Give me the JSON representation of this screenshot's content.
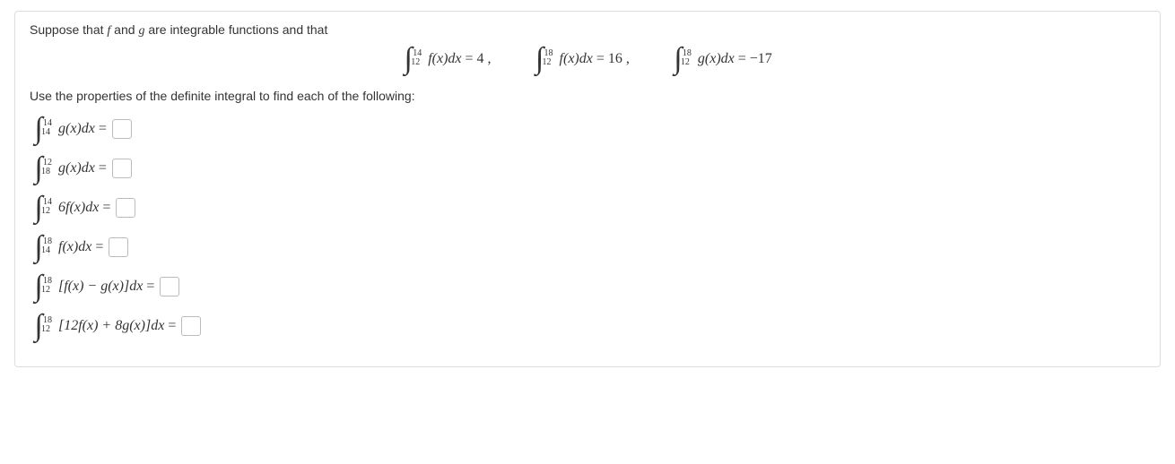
{
  "intro": {
    "pre": "Suppose that ",
    "f": "f",
    "mid": " and ",
    "g": "g",
    "post": " are integrable functions and that"
  },
  "given": {
    "int1": {
      "lower": "12",
      "upper": "14",
      "body": "f(x)dx",
      "eq": "= 4 ,",
      "result": ""
    },
    "int2": {
      "lower": "12",
      "upper": "18",
      "body": "f(x)dx",
      "eq": "= 16 ,",
      "result": ""
    },
    "int3": {
      "lower": "12",
      "upper": "18",
      "body": "g(x)dx",
      "eq": "= −17",
      "result": ""
    }
  },
  "instructions": "Use the properties of the definite integral to find each of the following:",
  "questions": [
    {
      "lower": "14",
      "upper": "14",
      "body": "g(x)dx",
      "answer": ""
    },
    {
      "lower": "18",
      "upper": "12",
      "body": "g(x)dx",
      "answer": ""
    },
    {
      "lower": "12",
      "upper": "14",
      "body": "6f(x)dx",
      "answer": ""
    },
    {
      "lower": "14",
      "upper": "18",
      "body": "f(x)dx",
      "answer": ""
    },
    {
      "lower": "12",
      "upper": "18",
      "body": "[f(x) − g(x)]dx",
      "answer": ""
    },
    {
      "lower": "12",
      "upper": "18",
      "body": "[12f(x) + 8g(x)]dx",
      "answer": ""
    }
  ]
}
